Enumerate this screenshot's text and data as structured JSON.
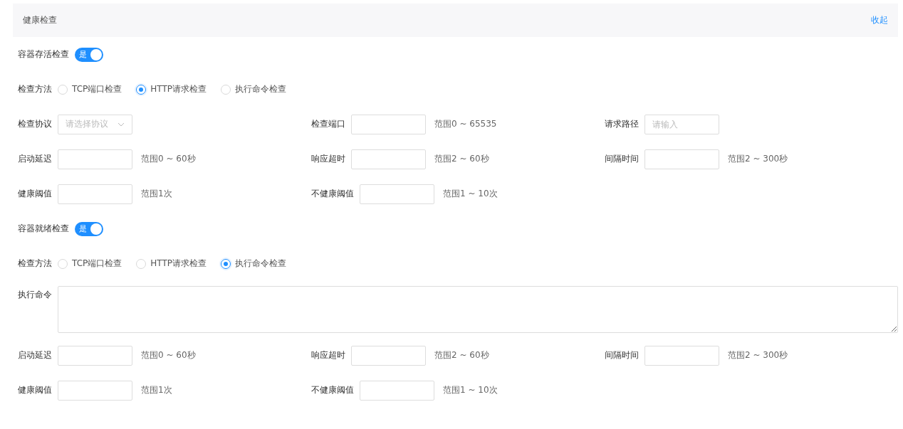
{
  "header": {
    "title": "健康检查",
    "action": "收起"
  },
  "sections": [
    {
      "toggle": {
        "label": "容器存活检查",
        "on": true,
        "text": "是"
      },
      "method": {
        "label": "检查方法",
        "options": [
          {
            "label": "TCP端口检查",
            "selected": false
          },
          {
            "label": "HTTP请求检查",
            "selected": true
          },
          {
            "label": "执行命令检查",
            "selected": false
          }
        ]
      },
      "rows": [
        [
          {
            "kind": "select",
            "label": "检查协议",
            "placeholder": "请选择协议"
          },
          {
            "kind": "input",
            "label": "检查端口",
            "hint": "范围0 ~ 65535"
          },
          {
            "kind": "input",
            "label": "请求路径",
            "placeholder": "请输入"
          }
        ],
        [
          {
            "kind": "input",
            "label": "启动延迟",
            "hint": "范围0 ~ 60秒"
          },
          {
            "kind": "input",
            "label": "响应超时",
            "hint": "范围2 ~ 60秒"
          },
          {
            "kind": "input",
            "label": "间隔时间",
            "hint": "范围2 ~ 300秒"
          }
        ],
        [
          {
            "kind": "input",
            "label": "健康阈值",
            "hint": "范围1次"
          },
          {
            "kind": "input",
            "label": "不健康阈值",
            "hint": "范围1 ~ 10次"
          }
        ]
      ]
    },
    {
      "toggle": {
        "label": "容器就绪检查",
        "on": true,
        "text": "是"
      },
      "method": {
        "label": "检查方法",
        "options": [
          {
            "label": "TCP端口检查",
            "selected": false
          },
          {
            "label": "HTTP请求检查",
            "selected": false
          },
          {
            "label": "执行命令检查",
            "selected": true
          }
        ]
      },
      "rows": [
        [
          {
            "kind": "textarea",
            "label": "执行命令"
          }
        ],
        [
          {
            "kind": "input",
            "label": "启动延迟",
            "hint": "范围0 ~ 60秒"
          },
          {
            "kind": "input",
            "label": "响应超时",
            "hint": "范围2 ~ 60秒"
          },
          {
            "kind": "input",
            "label": "间隔时间",
            "hint": "范围2 ~ 300秒"
          }
        ],
        [
          {
            "kind": "input",
            "label": "健康阈值",
            "hint": "范围1次"
          },
          {
            "kind": "input",
            "label": "不健康阈值",
            "hint": "范围1 ~ 10次"
          }
        ]
      ]
    }
  ]
}
